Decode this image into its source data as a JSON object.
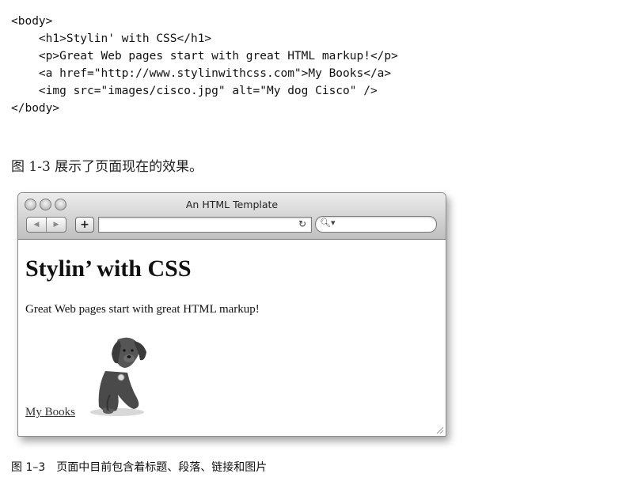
{
  "code_lines": [
    "<body>",
    "    <h1>Stylin' with CSS</h1>",
    "    <p>Great Web pages start with great HTML markup!</p>",
    "    <a href=\"http://www.stylinwithcss.com\">My Books</a>",
    "    <img src=\"images/cisco.jpg\" alt=\"My dog Cisco\" />",
    "</body>"
  ],
  "paragraph": "图 1-3 展示了页面现在的效果。",
  "browser": {
    "window_title": "An HTML Template",
    "back_icon": "back-arrow-icon",
    "forward_icon": "forward-arrow-icon",
    "add_label": "+",
    "reload_icon": "reload-icon",
    "search_icon": "magnifier-icon",
    "page": {
      "heading": "Stylin’ with CSS",
      "text": "Great Web pages start with great HTML markup!",
      "link": "My Books",
      "image_alt": "My dog Cisco"
    }
  },
  "caption": {
    "number": "图 1–3",
    "text": "页面中目前包含着标题、段落、链接和图片"
  }
}
